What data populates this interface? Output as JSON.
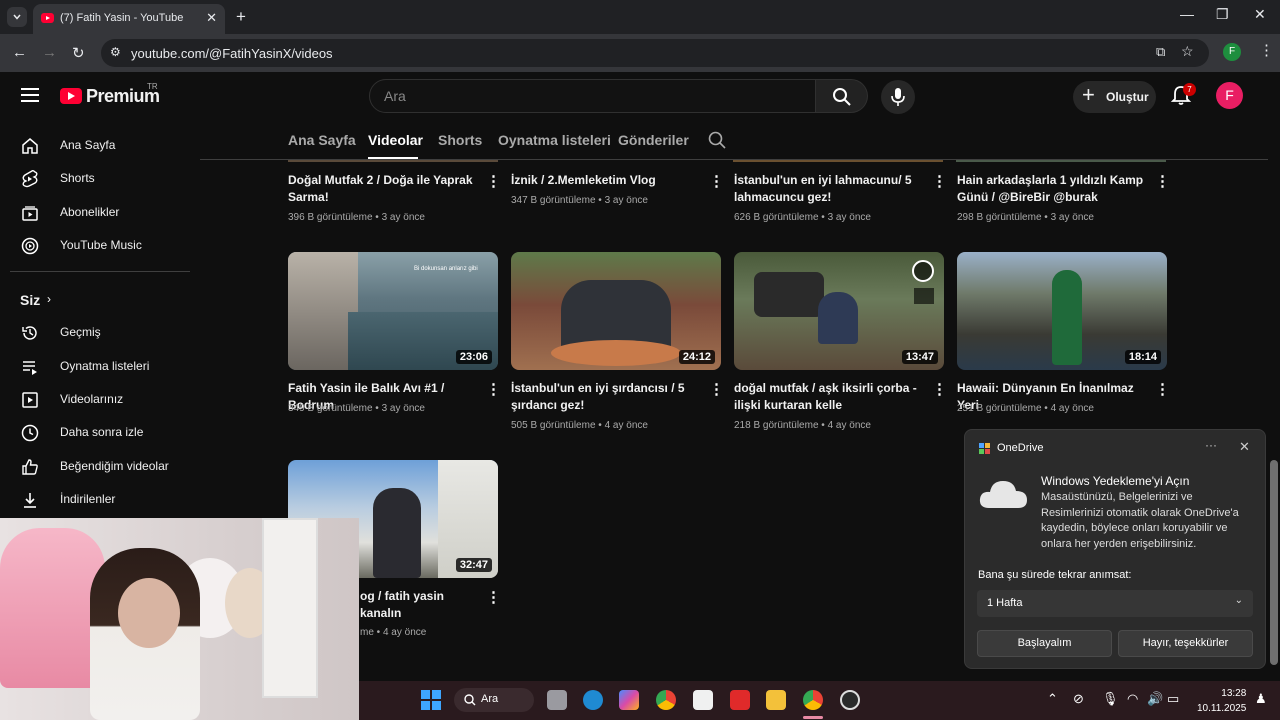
{
  "browser": {
    "tab_title": "(7) Fatih Yasin - YouTube",
    "url": "youtube.com/@FatihYasinX/videos",
    "profile_initial": "F"
  },
  "header": {
    "logo_text": "Premium",
    "logo_sup": "TR",
    "search_placeholder": "Ara",
    "create_label": "Oluştur",
    "notification_count": "7",
    "avatar_initial": "F"
  },
  "sidebar": {
    "items": [
      {
        "label": "Ana Sayfa",
        "icon": "home-icon"
      },
      {
        "label": "Shorts",
        "icon": "shorts-icon"
      },
      {
        "label": "Abonelikler",
        "icon": "subscriptions-icon"
      },
      {
        "label": "YouTube Music",
        "icon": "music-icon"
      }
    ],
    "section_title": "Siz",
    "you_items": [
      {
        "label": "Geçmiş",
        "icon": "history-icon"
      },
      {
        "label": "Oynatma listeleri",
        "icon": "playlists-icon"
      },
      {
        "label": "Videolarınız",
        "icon": "your-videos-icon"
      },
      {
        "label": "Daha sonra izle",
        "icon": "watch-later-icon"
      },
      {
        "label": "Beğendiğim videolar",
        "icon": "liked-icon"
      },
      {
        "label": "İndirilenler",
        "icon": "downloads-icon"
      }
    ]
  },
  "channel_tabs": [
    "Ana Sayfa",
    "Videolar",
    "Shorts",
    "Oynatma listeleri",
    "Gönderiler"
  ],
  "videos_row1": [
    {
      "title": "Doğal Mutfak 2 / Doğa ile Yaprak Sarma!",
      "views": "396 B görüntüleme",
      "age": "3 ay önce"
    },
    {
      "title": "İznik / 2.Memleketim Vlog",
      "views": "347 B görüntüleme",
      "age": "3 ay önce"
    },
    {
      "title": "İstanbul'un en iyi lahmacunu/ 5 lahmacuncu gez!",
      "views": "626 B görüntüleme",
      "age": "3 ay önce"
    },
    {
      "title": "Hain arkadaşlarla 1 yıldızlı Kamp Günü / @BireBir @burak",
      "views": "298 B görüntüleme",
      "age": "3 ay önce"
    }
  ],
  "videos_row2": [
    {
      "title": "Fatih Yasin ile Balık Avı #1 / Bodrum",
      "views": "349 B görüntüleme",
      "age": "3 ay önce",
      "duration": "23:06",
      "overlay": "Bi dokunsan anlarız gibi"
    },
    {
      "title": "İstanbul'un en iyi şırdancısı / 5 şırdancı gez!",
      "views": "505 B görüntüleme",
      "age": "4 ay önce",
      "duration": "24:12"
    },
    {
      "title": "doğal mutfak / aşk iksirli çorba - ilişki kurtaran kelle",
      "views": "218 B görüntüleme",
      "age": "4 ay önce",
      "duration": "13:47"
    },
    {
      "title": "Hawaii: Dünyanın En İnanılmaz Yeri",
      "views": "251 B görüntüleme",
      "age": "4 ay önce",
      "duration": "18:14"
    }
  ],
  "videos_row3": [
    {
      "title": "og / fatih yasin kanalın",
      "views": "me",
      "age": "4 ay önce",
      "duration": "32:47"
    }
  ],
  "onedrive": {
    "app_name": "OneDrive",
    "heading": "Windows Yedekleme'yi Açın",
    "body": "Masaüstünüzü, Belgelerinizi ve Resimlerinizi otomatik olarak OneDrive'a kaydedin, böylece onları koruyabilir ve onlara her yerden erişebilirsiniz.",
    "question": "Bana şu sürede tekrar anımsat:",
    "select_value": "1 Hafta",
    "primary_button": "Başlayalım",
    "secondary_button": "Hayır, teşekkürler"
  },
  "taskbar": {
    "search_label": "Ara",
    "time": "13:28",
    "date": "10.11.2025"
  }
}
